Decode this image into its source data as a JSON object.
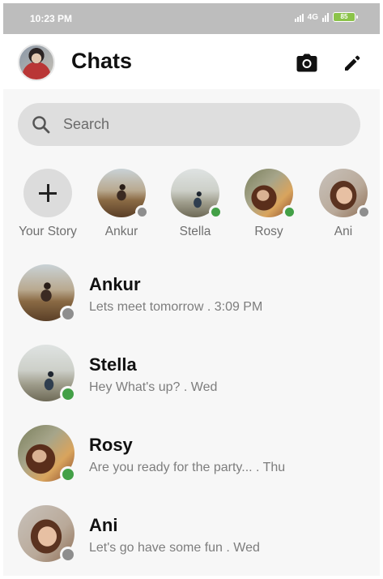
{
  "status_bar": {
    "time": "10:23 PM",
    "network": "4G",
    "battery": "85"
  },
  "header": {
    "title": "Chats",
    "avatar_icon": "profile-avatar",
    "camera_icon": "camera-icon",
    "compose_icon": "pencil-icon"
  },
  "search": {
    "placeholder": "Search",
    "icon": "search-icon"
  },
  "stories": [
    {
      "label": "Your Story",
      "type": "add",
      "icon": "plus-icon"
    },
    {
      "label": "Ankur",
      "status": "offline"
    },
    {
      "label": "Stella",
      "status": "online"
    },
    {
      "label": "Rosy",
      "status": "online"
    },
    {
      "label": "Ani",
      "status": "offline"
    }
  ],
  "chats": [
    {
      "name": "Ankur",
      "preview": "Lets meet tomorrow . 3:09 PM",
      "status": "offline"
    },
    {
      "name": "Stella",
      "preview": "Hey What's up? . Wed",
      "status": "online"
    },
    {
      "name": "Rosy",
      "preview": "Are you ready for the party... . Thu",
      "status": "online"
    },
    {
      "name": "Ani",
      "preview": "Let's go have some fun . Wed",
      "status": "offline"
    }
  ],
  "colors": {
    "online": "#43a047",
    "offline": "#8e8e8e",
    "status_bar": "#bdbdbd",
    "battery": "#8bc34a"
  }
}
